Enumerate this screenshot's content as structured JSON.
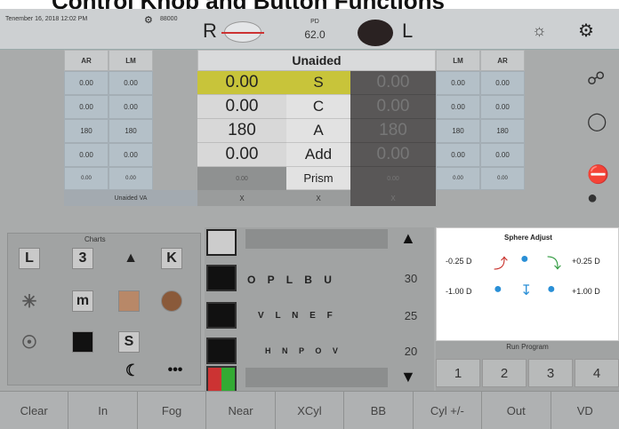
{
  "banner": {
    "title": "Control Knob and Button Functions"
  },
  "topbar": {
    "date": "Tenember 16, 2018  12:02 PM",
    "small_text": "88000",
    "right_eye": "R",
    "left_eye": "L",
    "pd_label": "PD",
    "pd_value": "62.0"
  },
  "refraction": {
    "left_headers": [
      "AR",
      "LM"
    ],
    "right_headers": [
      "LM",
      "AR"
    ],
    "mode": "Unaided",
    "rows": [
      {
        "label": "S",
        "left": [
          "0.00",
          "0.00"
        ],
        "center_r": "0.00",
        "center_l": "0.00",
        "right": [
          "0.00",
          "0.00"
        ]
      },
      {
        "label": "C",
        "left": [
          "0.00",
          "0.00"
        ],
        "center_r": "0.00",
        "center_l": "0.00",
        "right": [
          "0.00",
          "0.00"
        ]
      },
      {
        "label": "A",
        "left": [
          "180",
          "180"
        ],
        "center_r": "180",
        "center_l": "180",
        "right": [
          "180",
          "180"
        ]
      },
      {
        "label": "Add",
        "left": [
          "0.00",
          "0.00"
        ],
        "center_r": "0.00",
        "center_l": "0.00",
        "right": [
          "0.00",
          "0.00"
        ]
      }
    ],
    "prism_label": "Prism",
    "prism_small": "0.00",
    "unaided_va": "Unaided VA",
    "x_mark": "X"
  },
  "charts": {
    "title": "Charts",
    "letters": [
      "L",
      "3",
      "K",
      "m",
      "S"
    ]
  },
  "optotypes": {
    "line1": "O P L B U",
    "line2": "V L N E F",
    "line3": "H N P O V",
    "acuity": [
      "30",
      "25",
      "20"
    ]
  },
  "sphere_adjust": {
    "title": "Sphere Adjust",
    "minus_small": "-0.25 D",
    "plus_small": "+0.25 D",
    "minus_large": "-1.00 D",
    "plus_large": "+1.00 D"
  },
  "run_program": {
    "title": "Run Program",
    "buttons": [
      "1",
      "2",
      "3",
      "4"
    ]
  },
  "bottom_buttons": [
    "Clear",
    "In",
    "Fog",
    "Near",
    "XCyl",
    "BB",
    "Cyl +/-",
    "Out",
    "VD"
  ],
  "colors": {
    "highlight": "#c8c43a",
    "panel": "#a9abab",
    "red_arrow": "#c8302a",
    "green_arrow": "#2f9a3f",
    "blue_knob": "#2a8fd6"
  }
}
